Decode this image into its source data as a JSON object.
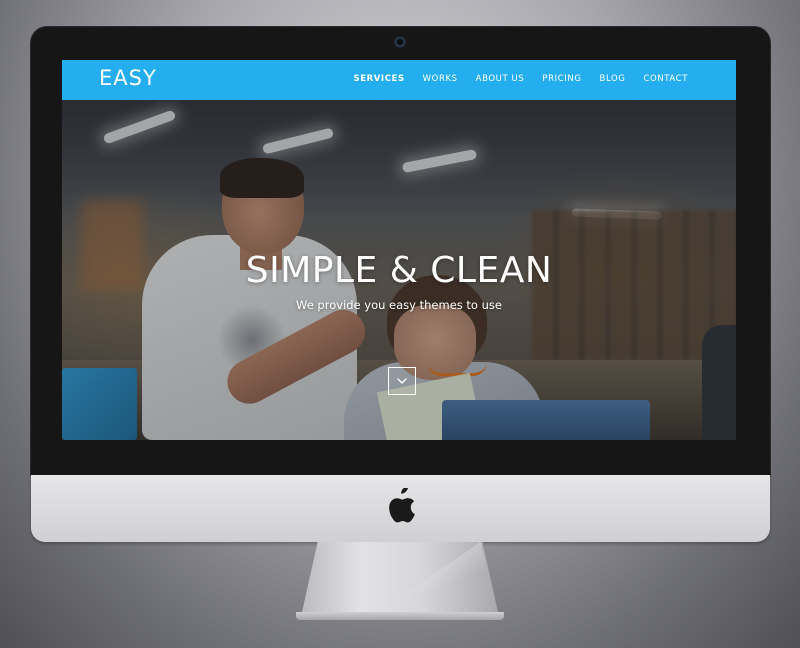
{
  "site": {
    "brand": "EASY",
    "accent_color": "#24aef0"
  },
  "nav": {
    "items": [
      {
        "label": "SERVICES",
        "active": true
      },
      {
        "label": "WORKS",
        "active": false
      },
      {
        "label": "ABOUT US",
        "active": false
      },
      {
        "label": "PRICING",
        "active": false
      },
      {
        "label": "BLOG",
        "active": false
      },
      {
        "label": "CONTACT",
        "active": false
      }
    ]
  },
  "hero": {
    "title": "SIMPLE & CLEAN",
    "subtitle": "We provide you easy themes to use",
    "scroll_icon": "chevron-down-icon"
  },
  "device": {
    "logo_icon": "apple-logo-icon",
    "camera_icon": "camera-icon"
  }
}
